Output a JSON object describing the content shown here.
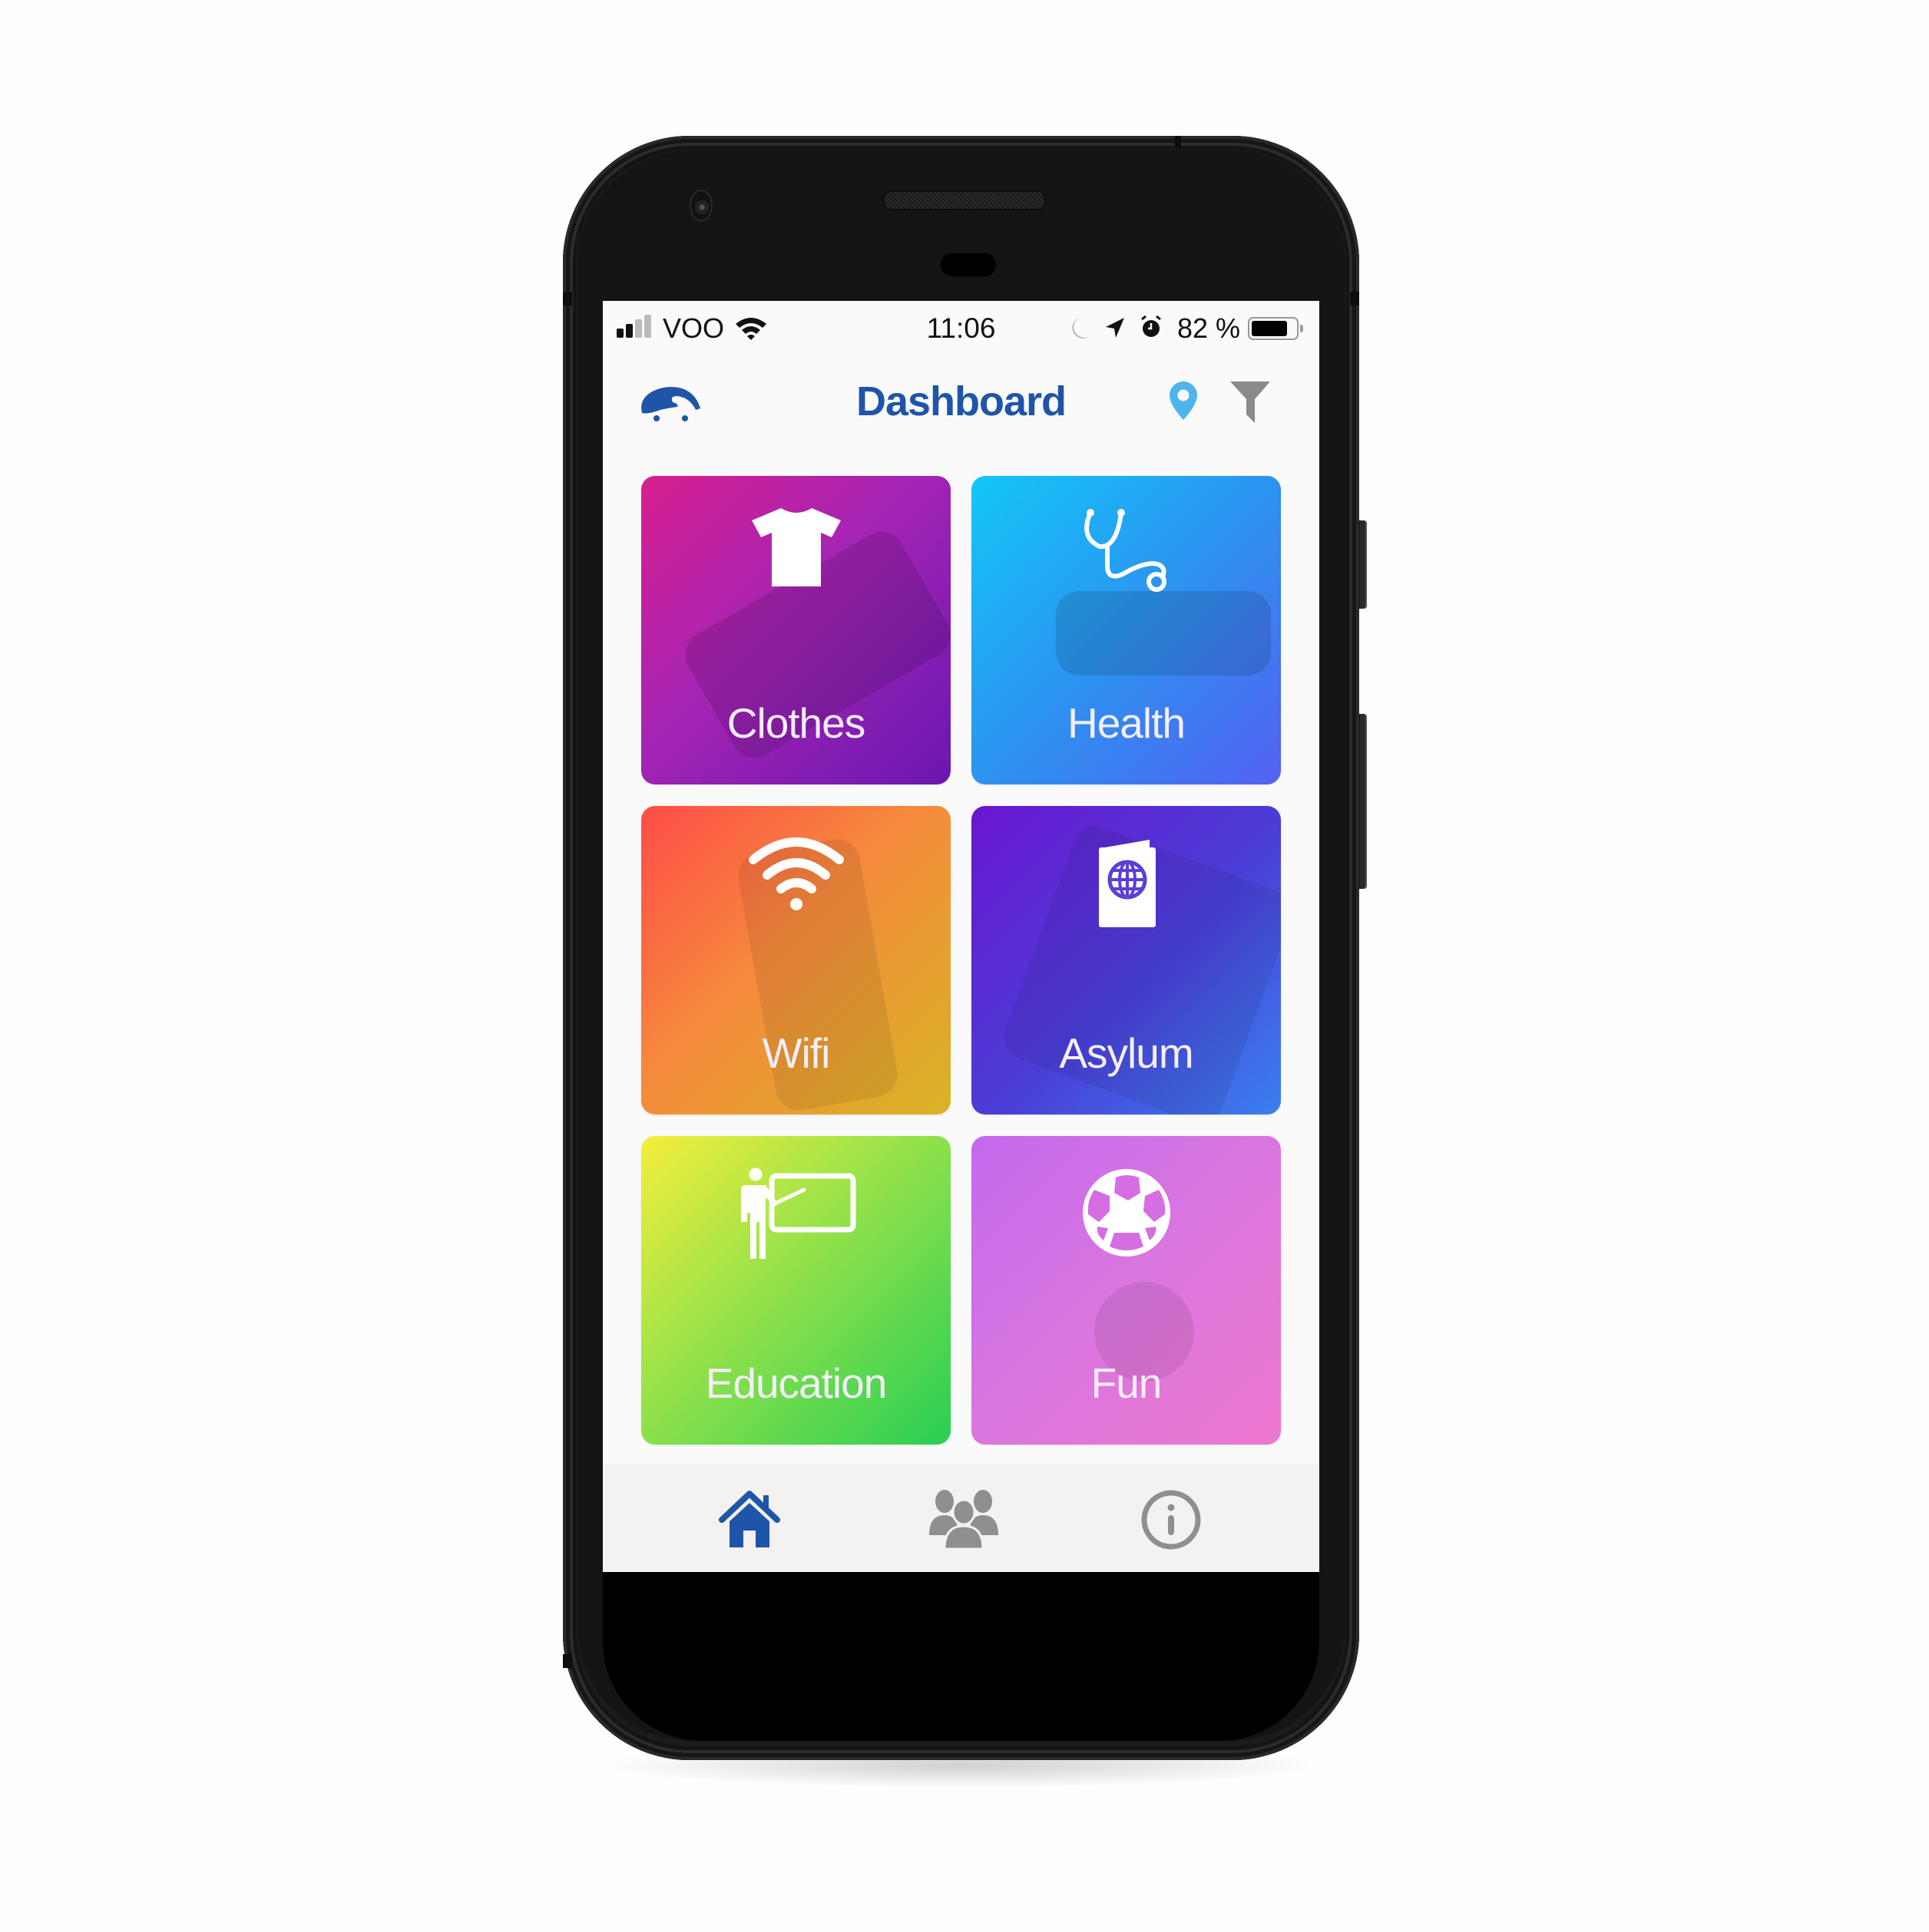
{
  "status_bar": {
    "carrier": "VOO",
    "time": "11:06",
    "battery_percent_label": "82 %",
    "battery_level": 0.82,
    "signal_bars_active": 2,
    "signal_bars_total": 4,
    "icons": [
      "signal-icon",
      "wifi-icon",
      "do-not-disturb-moon-icon",
      "location-arrow-icon",
      "alarm-icon",
      "battery-icon"
    ]
  },
  "header": {
    "title": "Dashboard",
    "logo": "app-logo-icon",
    "actions": [
      {
        "name": "location-pin-icon",
        "color": "#4fb3ee"
      },
      {
        "name": "filter-icon",
        "color": "#8a8a8a"
      }
    ],
    "title_color": "#1f55a8"
  },
  "tiles": [
    {
      "label": "Clothes",
      "icon": "tshirt-icon",
      "gradient": [
        "#d81f8f",
        "#a424b4",
        "#6a17b0"
      ]
    },
    {
      "label": "Health",
      "icon": "stethoscope-icon",
      "gradient": [
        "#12c7f8",
        "#2f8ef0",
        "#5560f2"
      ]
    },
    {
      "label": "Wifi",
      "icon": "wifi-icon",
      "gradient": [
        "#ff4c48",
        "#f58a3c",
        "#d8b425"
      ]
    },
    {
      "label": "Asylum",
      "icon": "passport-icon",
      "gradient": [
        "#6a16cf",
        "#4a3fd8",
        "#3a80ef"
      ]
    },
    {
      "label": "Education",
      "icon": "teacher-board-icon",
      "gradient": [
        "#f4ee3c",
        "#94e24a",
        "#28cf55"
      ]
    },
    {
      "label": "Fun",
      "icon": "soccer-ball-icon",
      "gradient": [
        "#c569ee",
        "#da76df",
        "#ee78cf"
      ]
    }
  ],
  "tab_bar": {
    "tabs": [
      {
        "name": "home",
        "icon": "home-icon",
        "active": true,
        "color": "#1f55a8"
      },
      {
        "name": "community",
        "icon": "people-icon",
        "active": false,
        "color": "#8f8f8f"
      },
      {
        "name": "info",
        "icon": "info-icon",
        "active": false,
        "color": "#8f8f8f"
      }
    ]
  }
}
